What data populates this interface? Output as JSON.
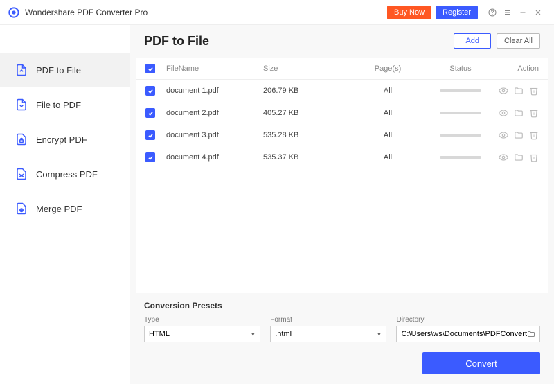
{
  "app": {
    "title": "Wondershare PDF Converter Pro"
  },
  "titlebar": {
    "buy": "Buy Now",
    "register": "Register"
  },
  "sidebar": {
    "items": [
      {
        "label": "PDF to File"
      },
      {
        "label": "File to PDF"
      },
      {
        "label": "Encrypt PDF"
      },
      {
        "label": "Compress PDF"
      },
      {
        "label": "Merge PDF"
      }
    ]
  },
  "header": {
    "title": "PDF to File",
    "add": "Add",
    "clear": "Clear All"
  },
  "columns": {
    "name": "FileName",
    "size": "Size",
    "pages": "Page(s)",
    "status": "Status",
    "action": "Action"
  },
  "files": [
    {
      "name": "document 1.pdf",
      "size": "206.79 KB",
      "pages": "All"
    },
    {
      "name": "document 2.pdf",
      "size": "405.27 KB",
      "pages": "All"
    },
    {
      "name": "document 3.pdf",
      "size": "535.28 KB",
      "pages": "All"
    },
    {
      "name": "document 4.pdf",
      "size": "535.37 KB",
      "pages": "All"
    }
  ],
  "presets": {
    "title": "Conversion Presets",
    "type_label": "Type",
    "type_value": "HTML",
    "format_label": "Format",
    "format_value": ".html",
    "directory_label": "Directory",
    "directory_value": "C:\\Users\\ws\\Documents\\PDFConvert"
  },
  "convert": "Convert"
}
